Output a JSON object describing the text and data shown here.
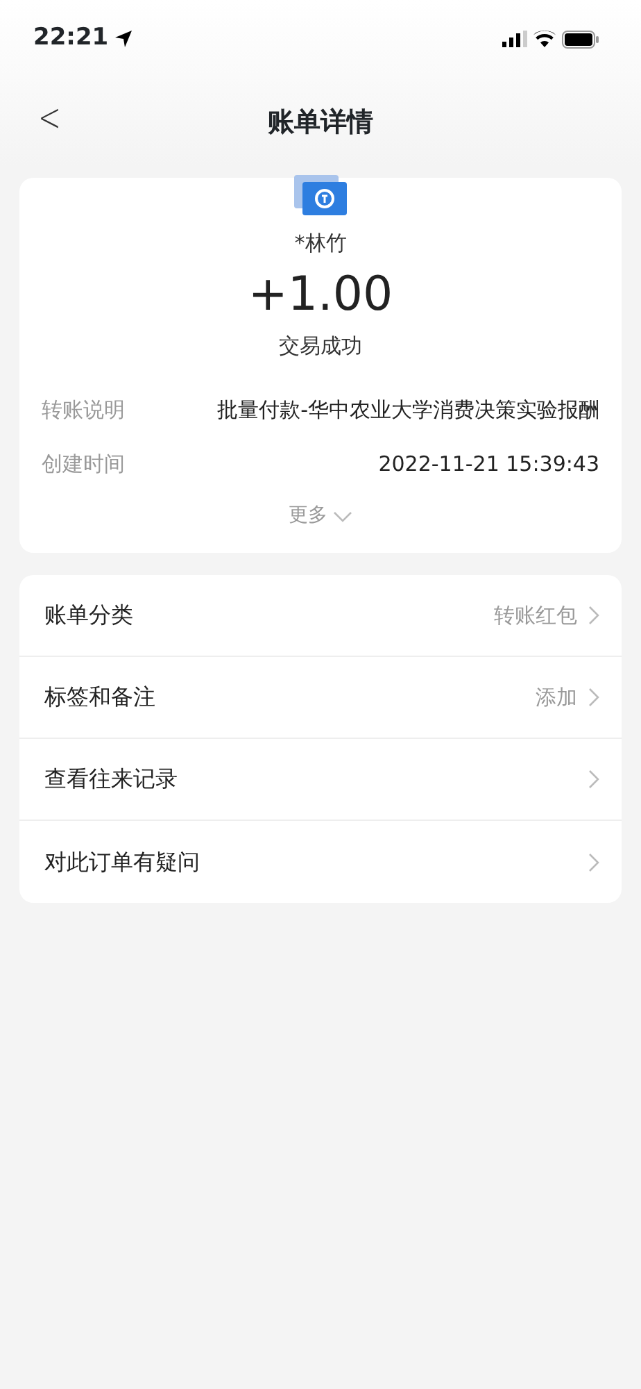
{
  "status_bar": {
    "time": "22:21"
  },
  "nav": {
    "back": "<",
    "title": "账单详情"
  },
  "summary": {
    "name": "*林竹",
    "amount": "+1.00",
    "status": "交易成功",
    "fields": [
      {
        "label": "转账说明",
        "value": "批量付款-华中农业大学消费决策实验报酬"
      },
      {
        "label": "创建时间",
        "value": "2022-11-21 15:39:43"
      }
    ],
    "more": "更多"
  },
  "menu": [
    {
      "label": "账单分类",
      "value": "转账红包"
    },
    {
      "label": "标签和备注",
      "value": "添加"
    },
    {
      "label": "查看往来记录"
    },
    {
      "label": "对此订单有疑问"
    }
  ]
}
